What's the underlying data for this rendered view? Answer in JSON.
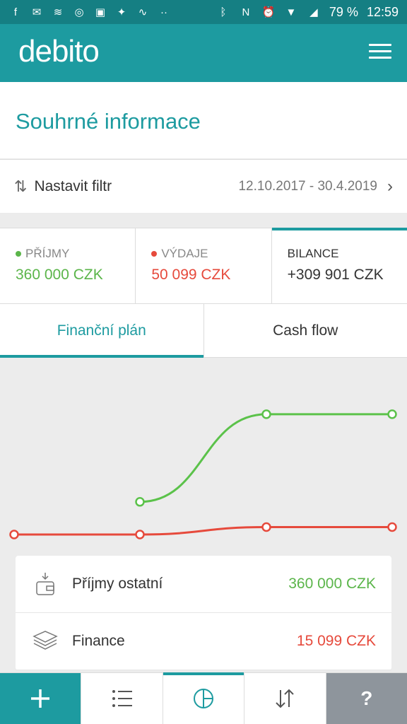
{
  "status": {
    "battery": "79 %",
    "time": "12:59"
  },
  "app": {
    "logo": "debito"
  },
  "page": {
    "title": "Souhrné informace"
  },
  "filter": {
    "label": "Nastavit filtr",
    "range": "12.10.2017 - 30.4.2019"
  },
  "summary": [
    {
      "caption": "PŘÍJMY",
      "value": "360 000 CZK",
      "color": "#5bb54a"
    },
    {
      "caption": "VÝDAJE",
      "value": "50 099 CZK",
      "color": "#e64a3c"
    },
    {
      "caption": "BILANCE",
      "value": "+309 901 CZK",
      "color": "#333333"
    }
  ],
  "tabs": [
    {
      "label": "Finanční plán"
    },
    {
      "label": "Cash flow"
    }
  ],
  "chart_data": {
    "type": "line",
    "x": [
      0,
      1,
      2,
      3
    ],
    "series": [
      {
        "values": [
          null,
          0.22,
          0.81,
          0.81
        ],
        "color": "#5bc24a"
      },
      {
        "values": [
          0.0,
          0.0,
          0.05,
          0.05
        ],
        "color": "#e64a3c"
      }
    ],
    "ylim": [
      0,
      1
    ]
  },
  "items": [
    {
      "name": "Příjmy ostatní",
      "amount": "360 000 CZK",
      "color": "#5bb54a",
      "icon": "wallet-icon"
    },
    {
      "name": "Finance",
      "amount": "15 099 CZK",
      "color": "#e64a3c",
      "icon": "money-stack-icon"
    }
  ],
  "bottomnav": {
    "help": "?"
  }
}
